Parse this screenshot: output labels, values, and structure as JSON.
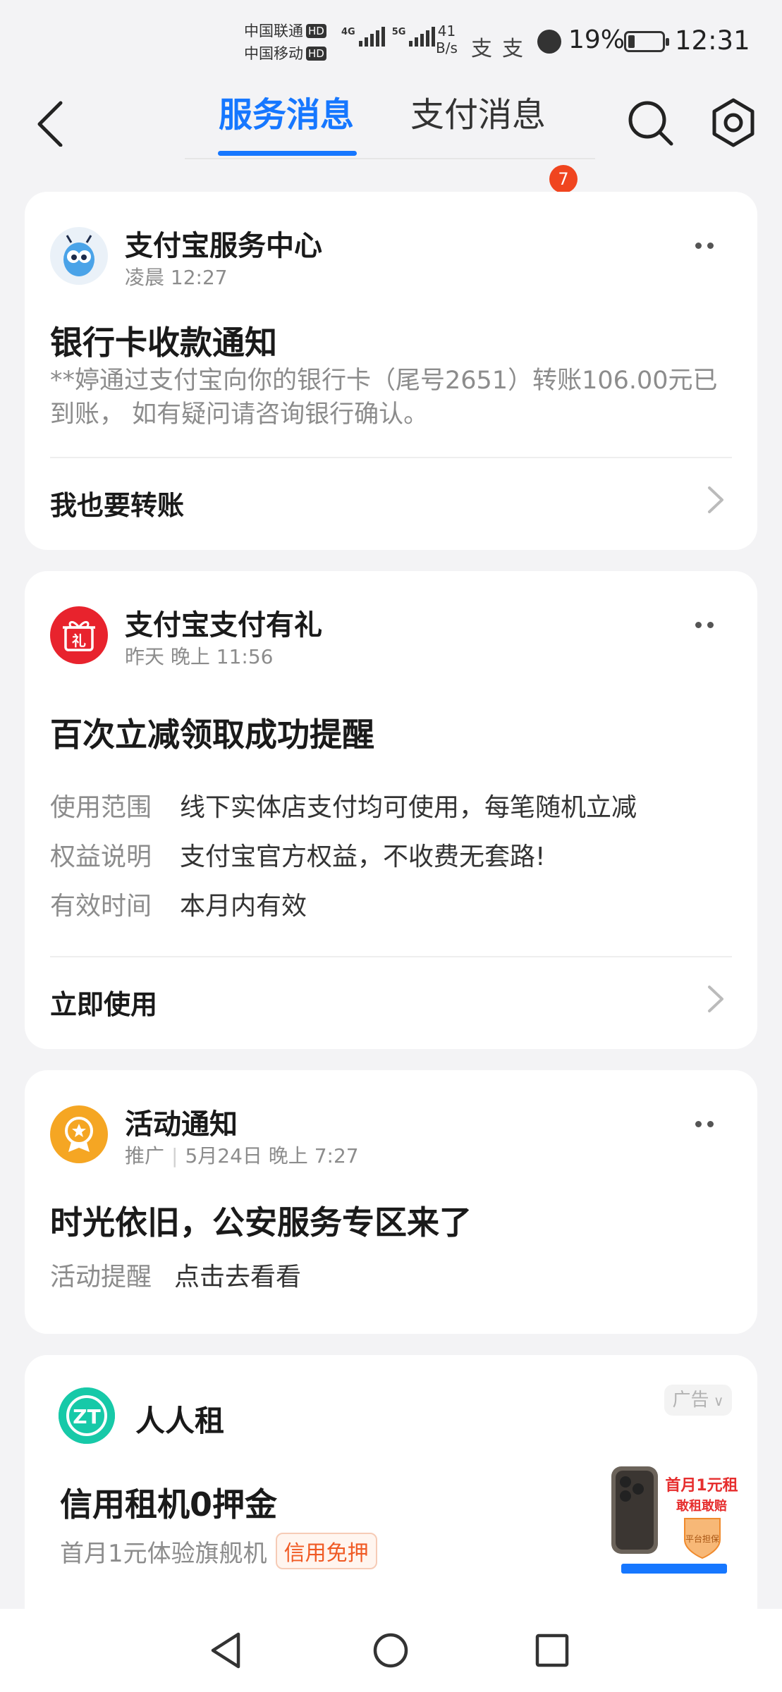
{
  "status_bar": {
    "carrier_1": "中国联通",
    "carrier_2": "中国移动",
    "hd": "HD",
    "net_1": "4G",
    "net_2": "5G",
    "speed_value": "41",
    "speed_unit": "B/s",
    "battery": "19%",
    "battery_level": 0.19,
    "time": "12:31"
  },
  "header": {
    "tab_service": "服务消息",
    "tab_payment": "支付消息",
    "payment_badge": "7",
    "accent": "#1677ff",
    "badge_color": "#f0451f"
  },
  "cards": [
    {
      "sender": "支付宝服务中心",
      "time": "凌晨 12:27",
      "title": "银行卡收款通知",
      "body": "**婷通过支付宝向你的银行卡（尾号2651）转账106.00元已到账， 如有疑问请咨询银行确认。",
      "action": "我也要转账"
    },
    {
      "sender": "支付宝支付有礼",
      "time": "昨天 晚上 11:56",
      "title": "百次立减领取成功提醒",
      "avatar_text": "礼",
      "details": [
        {
          "label": "使用范围",
          "value": "线下实体店支付均可使用，每笔随机立减"
        },
        {
          "label": "权益说明",
          "value": "支付宝官方权益，不收费无套路!"
        },
        {
          "label": "有效时间",
          "value": "本月内有效"
        }
      ],
      "action": "立即使用"
    },
    {
      "sender": "活动通知",
      "time_prefix": "推广",
      "time": "5月24日 晚上 7:27",
      "title": "时光依旧，公安服务专区来了",
      "details": [
        {
          "label": "活动提醒",
          "value": "点击去看看"
        }
      ]
    }
  ],
  "ad": {
    "brand": "人人租",
    "tag": "广告",
    "title": "信用租机0押金",
    "subtitle": "首月1元体验旗舰机",
    "pill": "信用免押",
    "image_text_1": "首月1元租",
    "image_text_2": "敢租敢赔",
    "image_text_3": "平台担保"
  },
  "icons": {
    "back": "back-arrow-icon",
    "search": "search-icon",
    "settings": "gear-icon",
    "more": "more-icon",
    "chevron": "chevron-right-icon",
    "nav_back": "triangle-back-icon",
    "nav_home": "circle-home-icon",
    "nav_recent": "square-recent-icon"
  }
}
